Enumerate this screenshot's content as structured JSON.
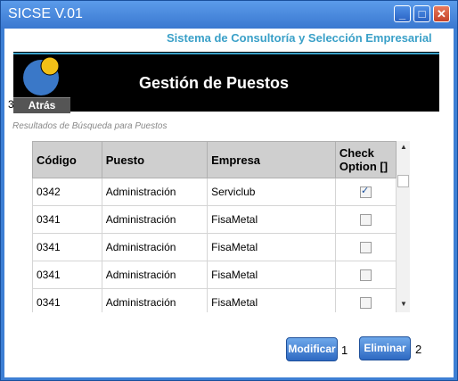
{
  "window": {
    "title": "SICSE V.01"
  },
  "header": {
    "subtitle": "Sistema de Consultoría y Selección Empresarial",
    "page_title": "Gestión de Puestos",
    "back_label": "Atrás",
    "back_index": "3"
  },
  "section_label": "Resultados de Búsqueda para Puestos",
  "table": {
    "headers": [
      "Código",
      "Puesto",
      "Empresa",
      "Check Option []"
    ],
    "rows": [
      {
        "codigo": "0342",
        "puesto": "Administración",
        "empresa": "Serviclub",
        "checked": true
      },
      {
        "codigo": "0341",
        "puesto": "Administración",
        "empresa": "FisaMetal",
        "checked": false
      },
      {
        "codigo": "0341",
        "puesto": "Administración",
        "empresa": "FisaMetal",
        "checked": false
      },
      {
        "codigo": "0341",
        "puesto": "Administración",
        "empresa": "FisaMetal",
        "checked": false
      },
      {
        "codigo": "0341",
        "puesto": "Administración",
        "empresa": "FisaMetal",
        "checked": false
      }
    ]
  },
  "buttons": {
    "modify_label": "Modificar",
    "modify_index": "1",
    "delete_label": "Eliminar",
    "delete_index": "2"
  },
  "colors": {
    "accent": "#3aa0c8",
    "title_bar": "#3d7fd4",
    "banner": "#000000"
  }
}
